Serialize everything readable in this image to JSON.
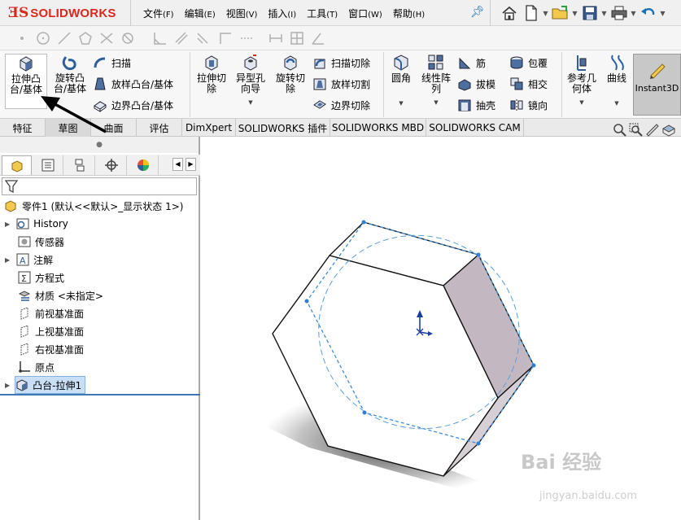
{
  "app": {
    "logo_text": "SOLIDWORKS",
    "brand_color": "#da291c",
    "accent_color": "#3c78b4"
  },
  "menu": {
    "items": [
      {
        "label": "文件",
        "acc": "(F)"
      },
      {
        "label": "编辑",
        "acc": "(E)"
      },
      {
        "label": "视图",
        "acc": "(V)"
      },
      {
        "label": "插入",
        "acc": "(I)"
      },
      {
        "label": "工具",
        "acc": "(T)"
      },
      {
        "label": "窗口",
        "acc": "(W)"
      },
      {
        "label": "帮助",
        "acc": "(H)"
      }
    ]
  },
  "features": {
    "extrude_boss": "拉伸凸台/基体",
    "revolve_boss": "旋转凸台/基体",
    "sweep": "扫描",
    "loft_boss": "放样凸台/基体",
    "boundary_boss": "边界凸台/基体",
    "extrude_cut": "拉伸切除",
    "hole_wizard": "异型孔向导",
    "revolve_cut": "旋转切除",
    "sweep_cut": "扫描切除",
    "loft_cut": "放样切割",
    "boundary_cut": "边界切除",
    "fillet": "圆角",
    "linear_pattern": "线性阵列",
    "rib": "筋",
    "draft": "拔模",
    "shell": "抽壳",
    "wrap": "包覆",
    "intersect": "相交",
    "mirror": "镜向",
    "ref_geometry": "参考几何体",
    "curves": "曲线",
    "instant3d": "Instant3D"
  },
  "tabs": [
    {
      "label": "特征",
      "active": false
    },
    {
      "label": "草图",
      "active": true
    },
    {
      "label": "曲面",
      "active": false
    },
    {
      "label": "评估",
      "active": false
    },
    {
      "label": "DimXpert",
      "active": false
    },
    {
      "label": "SOLIDWORKS 插件",
      "active": false
    },
    {
      "label": "SOLIDWORKS MBD",
      "active": false
    },
    {
      "label": "SOLIDWORKS CAM",
      "active": false
    }
  ],
  "tree": {
    "root": "零件1  (默认<<默认>_显示状态 1>)",
    "items": [
      {
        "label": "History",
        "expandable": true
      },
      {
        "label": "传感器",
        "expandable": false
      },
      {
        "label": "注解",
        "expandable": true
      },
      {
        "label": "方程式",
        "expandable": false
      },
      {
        "label": "材质 <未指定>",
        "expandable": false
      },
      {
        "label": "前视基准面",
        "expandable": false
      },
      {
        "label": "上视基准面",
        "expandable": false
      },
      {
        "label": "右视基准面",
        "expandable": false
      },
      {
        "label": "原点",
        "expandable": false
      },
      {
        "label": "凸台-拉伸1",
        "expandable": true,
        "selected": true
      }
    ]
  },
  "watermark": {
    "logo": "Bai 经验",
    "url": "jingyan.baidu.com"
  }
}
